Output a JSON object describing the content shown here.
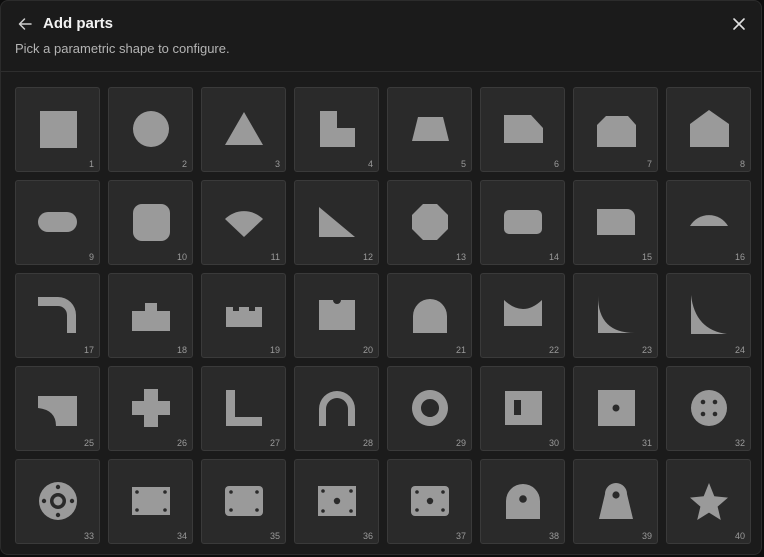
{
  "header": {
    "title": "Add parts",
    "subtitle": "Pick a parametric shape to configure."
  },
  "colors": {
    "shape": "#9a9a9a",
    "tile_bg": "#2a2a2a",
    "hole": "#2a2a2a"
  },
  "parts": [
    {
      "id": 1,
      "label": "1",
      "icon": "square-icon"
    },
    {
      "id": 2,
      "label": "2",
      "icon": "circle-icon"
    },
    {
      "id": 3,
      "label": "3",
      "icon": "triangle-icon"
    },
    {
      "id": 4,
      "label": "4",
      "icon": "notched-square-icon"
    },
    {
      "id": 5,
      "label": "5",
      "icon": "trapezoid-icon"
    },
    {
      "id": 6,
      "label": "6",
      "icon": "chamfered-corner-icon"
    },
    {
      "id": 7,
      "label": "7",
      "icon": "double-chamfer-icon"
    },
    {
      "id": 8,
      "label": "8",
      "icon": "pentagon-house-icon"
    },
    {
      "id": 9,
      "label": "9",
      "icon": "slot-icon"
    },
    {
      "id": 10,
      "label": "10",
      "icon": "rounded-square-icon"
    },
    {
      "id": 11,
      "label": "11",
      "icon": "sector-icon"
    },
    {
      "id": 12,
      "label": "12",
      "icon": "right-triangle-icon"
    },
    {
      "id": 13,
      "label": "13",
      "icon": "octagon-icon"
    },
    {
      "id": 14,
      "label": "14",
      "icon": "rounded-rectangle-icon"
    },
    {
      "id": 15,
      "label": "15",
      "icon": "rounded-corner-rectangle-icon"
    },
    {
      "id": 16,
      "label": "16",
      "icon": "circular-segment-icon"
    },
    {
      "id": 17,
      "label": "17",
      "icon": "bent-bar-icon"
    },
    {
      "id": 18,
      "label": "18",
      "icon": "stepped-block-icon"
    },
    {
      "id": 19,
      "label": "19",
      "icon": "castellated-block-icon"
    },
    {
      "id": 20,
      "label": "20",
      "icon": "notched-top-block-icon"
    },
    {
      "id": 21,
      "label": "21",
      "icon": "arch-icon"
    },
    {
      "id": 22,
      "label": "22",
      "icon": "concave-top-block-icon"
    },
    {
      "id": 23,
      "label": "23",
      "icon": "concave-fillet-icon"
    },
    {
      "id": 24,
      "label": "24",
      "icon": "concave-triangle-icon"
    },
    {
      "id": 25,
      "label": "25",
      "icon": "concave-corner-plate-icon"
    },
    {
      "id": 26,
      "label": "26",
      "icon": "cross-icon"
    },
    {
      "id": 27,
      "label": "27",
      "icon": "l-bracket-icon"
    },
    {
      "id": 28,
      "label": "28",
      "icon": "u-channel-icon"
    },
    {
      "id": 29,
      "label": "29",
      "icon": "ring-icon"
    },
    {
      "id": 30,
      "label": "30",
      "icon": "slotted-plate-icon"
    },
    {
      "id": 31,
      "label": "31",
      "icon": "center-hole-plate-icon"
    },
    {
      "id": 32,
      "label": "32",
      "icon": "bolt-circle-disc-icon"
    },
    {
      "id": 33,
      "label": "33",
      "icon": "flange-icon"
    },
    {
      "id": 34,
      "label": "34",
      "icon": "mounting-plate-icon"
    },
    {
      "id": 35,
      "label": "35",
      "icon": "rounded-mounting-plate-icon"
    },
    {
      "id": 36,
      "label": "36",
      "icon": "plate-center-hole-icon"
    },
    {
      "id": 37,
      "label": "37",
      "icon": "rounded-plate-center-hole-icon"
    },
    {
      "id": 38,
      "label": "38",
      "icon": "lifting-lug-icon"
    },
    {
      "id": 39,
      "label": "39",
      "icon": "tapered-lug-icon"
    },
    {
      "id": 40,
      "label": "40",
      "icon": "star-icon"
    }
  ]
}
